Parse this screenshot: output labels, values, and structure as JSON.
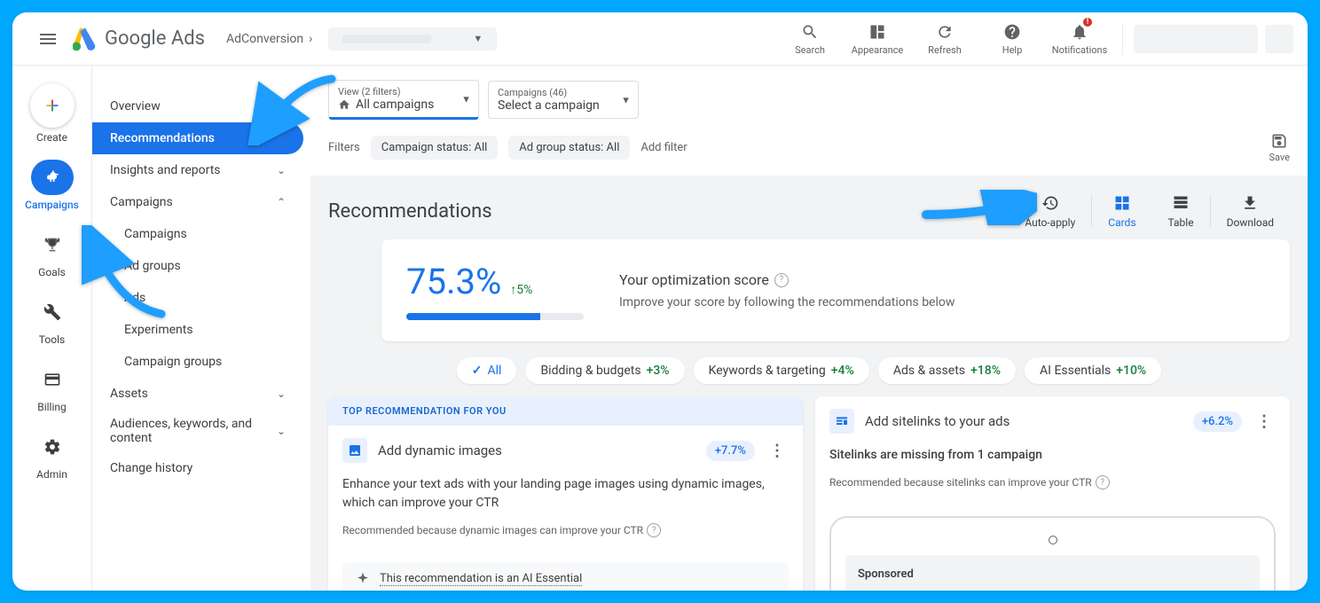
{
  "brand": "Google Ads",
  "breadcrumb": "AdConversion",
  "topbar": {
    "search": "Search",
    "appearance": "Appearance",
    "refresh": "Refresh",
    "help": "Help",
    "notifications": "Notifications"
  },
  "rail": {
    "create": "Create",
    "campaigns": "Campaigns",
    "goals": "Goals",
    "tools": "Tools",
    "billing": "Billing",
    "admin": "Admin"
  },
  "sidenav": {
    "overview": "Overview",
    "recommendations": "Recommendations",
    "insights": "Insights and reports",
    "campaigns": "Campaigns",
    "campaigns_sub": "Campaigns",
    "adgroups": "Ad groups",
    "ads": "Ads",
    "experiments": "Experiments",
    "campaign_groups": "Campaign groups",
    "assets": "Assets",
    "audiences": "Audiences, keywords, and content",
    "change_history": "Change history"
  },
  "selectors": {
    "view_label": "View (2 filters)",
    "view_value": "All campaigns",
    "campaigns_label": "Campaigns (46)",
    "campaigns_value": "Select a campaign"
  },
  "filters": {
    "label": "Filters",
    "chip1": "Campaign status: All",
    "chip2": "Ad group status: All",
    "add": "Add filter",
    "save": "Save"
  },
  "page_title": "Recommendations",
  "title_actions": {
    "auto_apply": "Auto-apply",
    "cards": "Cards",
    "table": "Table",
    "download": "Download"
  },
  "score": {
    "value": "75.3%",
    "delta": "5%",
    "title": "Your optimization score",
    "desc": "Improve your score by following the recommendations below"
  },
  "categories": {
    "all": "All",
    "bidding": "Bidding & budgets",
    "bidding_delta": "+3%",
    "keywords": "Keywords & targeting",
    "keywords_delta": "+4%",
    "ads": "Ads & assets",
    "ads_delta": "+18%",
    "ai": "AI Essentials",
    "ai_delta": "+10%"
  },
  "cards": {
    "top_banner": "TOP RECOMMENDATION FOR YOU",
    "c1": {
      "title": "Add dynamic images",
      "badge": "+7.7%",
      "desc": "Enhance your text ads with your landing page images using dynamic images, which can improve your CTR",
      "reason": "Recommended because dynamic images can improve your CTR",
      "ai_essential": "This recommendation is an AI Essential"
    },
    "c2": {
      "title": "Add sitelinks to your ads",
      "badge": "+6.2%",
      "desc": "Sitelinks are missing from 1 campaign",
      "reason": "Recommended because sitelinks can improve your CTR",
      "sponsored": "Sponsored"
    }
  }
}
